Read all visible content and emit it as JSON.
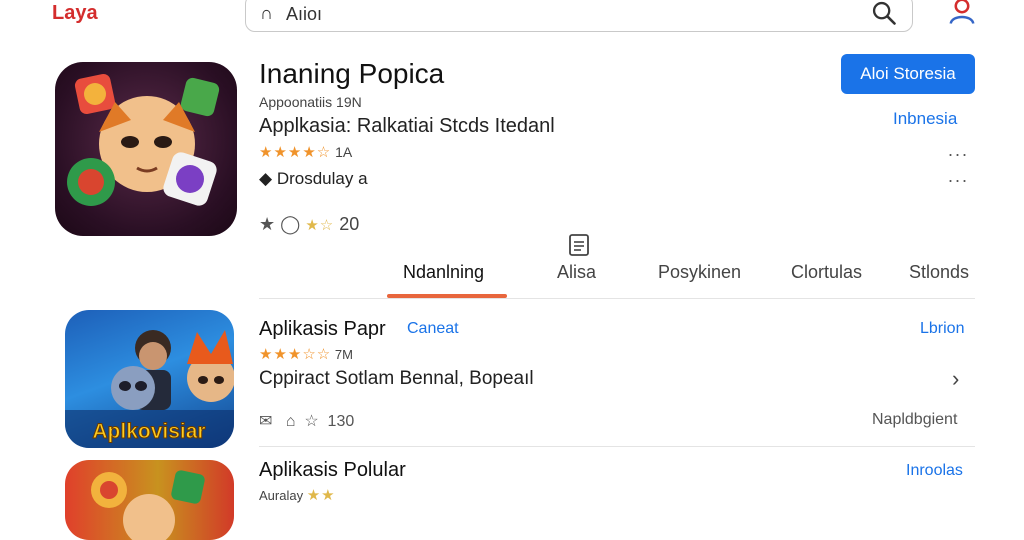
{
  "header": {
    "brand": "Laya",
    "search_text": "Aıioı"
  },
  "app": {
    "title": "Inaning Popica",
    "subtitle": "Appoonatiis 19N",
    "category_line": "Applkasia: Ralkatiai Stcds Itedanl",
    "rating_value": "1A",
    "stars": "★★★★☆",
    "developer": "Drosdulay a",
    "reviews_stars": "★☆",
    "reviews_count": "20",
    "install_label": "Aloi Storesia",
    "region_label": "Inbnesia",
    "more1": "...",
    "more2": "..."
  },
  "tabs": [
    {
      "label": "Ndanlning"
    },
    {
      "label": "Alisa"
    },
    {
      "label": "Posykinen"
    },
    {
      "label": "Clortulas"
    },
    {
      "label": "Stlonds"
    }
  ],
  "list": [
    {
      "name": "Aplikasis Papr",
      "tag": "Caneat",
      "right_link": "Lbrion",
      "stars": "★★★☆☆",
      "size": "7M",
      "desc": "Cppiract Sotlam Bennal, Bopeaıl",
      "icon_text": "Aplkovisiar",
      "meta_count": "130",
      "meta_right": "Napldbgient"
    },
    {
      "name": "Aplikasis Polular",
      "right_link": "Inroolas",
      "sub": "Auralay",
      "stars": "★★"
    }
  ],
  "colors": {
    "accent": "#1a73e8",
    "brand": "#d42d2d",
    "tab_indicator": "#e8663d",
    "star": "#f0932b"
  }
}
